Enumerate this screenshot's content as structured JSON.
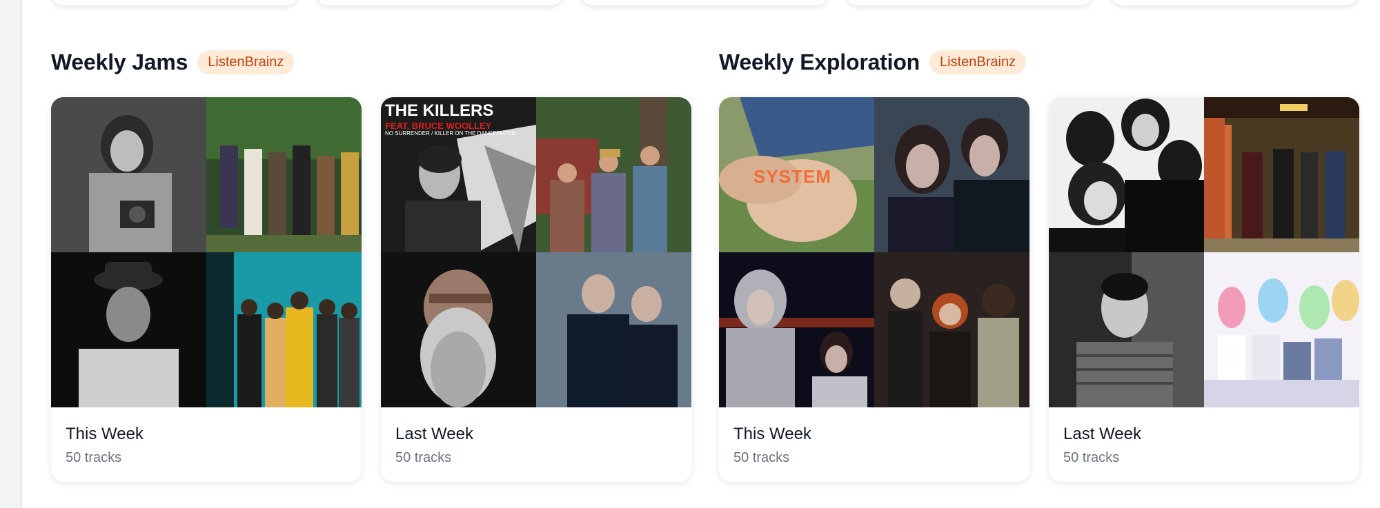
{
  "sections": [
    {
      "title": "Weekly Jams",
      "badge": "ListenBrainz",
      "cards": [
        {
          "title": "This Week",
          "subtitle": "50 tracks"
        },
        {
          "title": "Last Week",
          "subtitle": "50 tracks"
        }
      ]
    },
    {
      "title": "Weekly Exploration",
      "badge": "ListenBrainz",
      "cards": [
        {
          "title": "This Week",
          "subtitle": "50 tracks"
        },
        {
          "title": "Last Week",
          "subtitle": "50 tracks"
        }
      ]
    }
  ],
  "album_art": {
    "killers_title": "THE KILLERS",
    "killers_feat": "FEAT. BRUCE WOOLLEY",
    "killers_sub": "NO SURRENDER / KILLER ON THE DANCEFLOOR",
    "system_text": "SYSTEM"
  },
  "colors": {
    "badge_bg": "#fdebd8",
    "badge_text": "#c2410c",
    "card_bg": "#ffffff",
    "subtitle": "#6b7280"
  }
}
